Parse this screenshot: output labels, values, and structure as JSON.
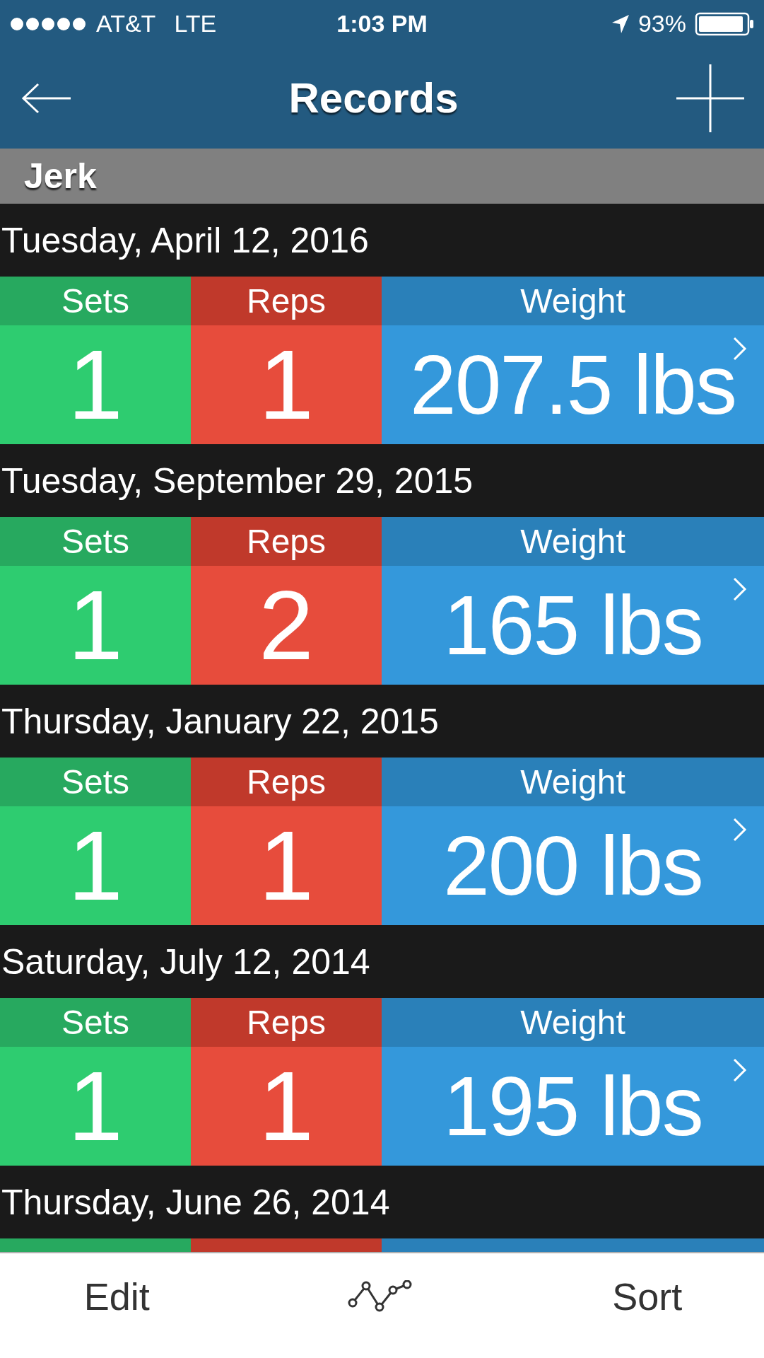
{
  "status_bar": {
    "carrier": "AT&T",
    "network": "LTE",
    "time": "1:03 PM",
    "battery": "93%"
  },
  "nav_bar": {
    "title": "Records"
  },
  "section": {
    "title": "Jerk"
  },
  "records": [
    {
      "date": "Tuesday, April 12, 2016",
      "sets_label": "Sets",
      "reps_label": "Reps",
      "weight_label": "Weight",
      "sets": "1",
      "reps": "1",
      "weight": "207.5 lbs"
    },
    {
      "date": "Tuesday, September 29, 2015",
      "sets_label": "Sets",
      "reps_label": "Reps",
      "weight_label": "Weight",
      "sets": "1",
      "reps": "2",
      "weight": "165 lbs"
    },
    {
      "date": "Thursday, January 22, 2015",
      "sets_label": "Sets",
      "reps_label": "Reps",
      "weight_label": "Weight",
      "sets": "1",
      "reps": "1",
      "weight": "200 lbs"
    },
    {
      "date": "Saturday, July 12, 2014",
      "sets_label": "Sets",
      "reps_label": "Reps",
      "weight_label": "Weight",
      "sets": "1",
      "reps": "1",
      "weight": "195 lbs"
    }
  ],
  "next_date": "Thursday, June 26, 2014",
  "tab_bar": {
    "edit": "Edit",
    "sort": "Sort"
  }
}
